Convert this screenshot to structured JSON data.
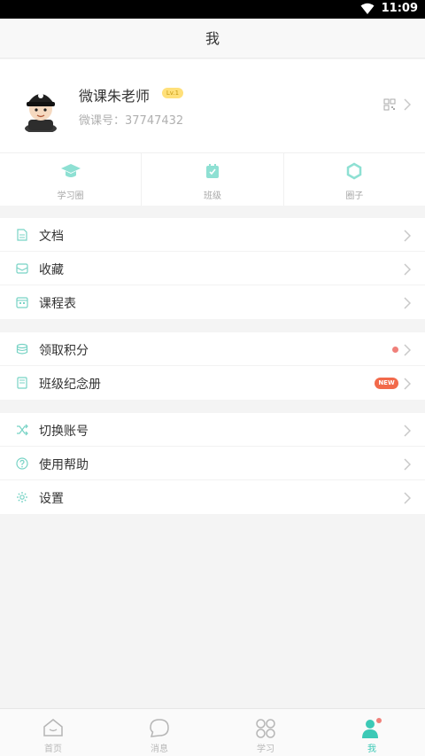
{
  "statusbar": {
    "time": "11:09"
  },
  "header": {
    "title": "我"
  },
  "profile": {
    "name": "微课朱老师",
    "level": "Lv.1",
    "id_text": "微课号：37747432"
  },
  "quick": [
    {
      "label": "学习圈",
      "icon": "graduation-cap-icon"
    },
    {
      "label": "班级",
      "icon": "class-badge-icon"
    },
    {
      "label": "圈子",
      "icon": "hexagon-icon"
    }
  ],
  "group1": [
    {
      "label": "文档",
      "icon": "document-icon"
    },
    {
      "label": "收藏",
      "icon": "collect-box-icon"
    },
    {
      "label": "课程表",
      "icon": "calendar-icon"
    }
  ],
  "group2": [
    {
      "label": "领取积分",
      "icon": "coins-icon"
    },
    {
      "label": "班级纪念册",
      "icon": "album-icon",
      "badge": "NEW"
    }
  ],
  "group3": [
    {
      "label": "切换账号",
      "icon": "shuffle-icon"
    },
    {
      "label": "使用帮助",
      "icon": "help-icon"
    },
    {
      "label": "设置",
      "icon": "gear-icon"
    }
  ],
  "tabs": [
    {
      "label": "首页",
      "icon": "home-icon"
    },
    {
      "label": "消息",
      "icon": "message-icon"
    },
    {
      "label": "学习",
      "icon": "grid-icon"
    },
    {
      "label": "我",
      "icon": "user-icon",
      "active": true
    }
  ],
  "colors": {
    "accent": "#3cc9b6",
    "badge_new": "#f26a4b",
    "level_badge": "#ffe07a",
    "notify_dot": "#f0807a"
  }
}
